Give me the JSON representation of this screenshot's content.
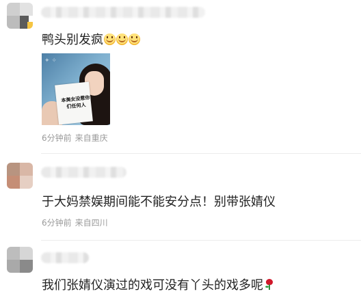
{
  "comments": [
    {
      "text": "鸭头别发疯",
      "emoji": [
        "dizzy-face-emoji",
        "dizzy-face-emoji",
        "dizzy-face-emoji"
      ],
      "image_sign_text": "本美女没惹你们任何人",
      "time": "6分钟前",
      "location": "来自重庆"
    },
    {
      "text": "于大妈禁娱期间能不能安分点！别带张婧仪",
      "time": "6分钟前",
      "location": "来自四川"
    },
    {
      "text": "我们张婧仪演过的戏可没有丫头的戏多呢",
      "emoji": [
        "rose-emoji"
      ]
    }
  ],
  "colors": {
    "text": "#222222",
    "meta": "#9a9a9a",
    "divider": "#ececec",
    "background": "#ffffff"
  }
}
